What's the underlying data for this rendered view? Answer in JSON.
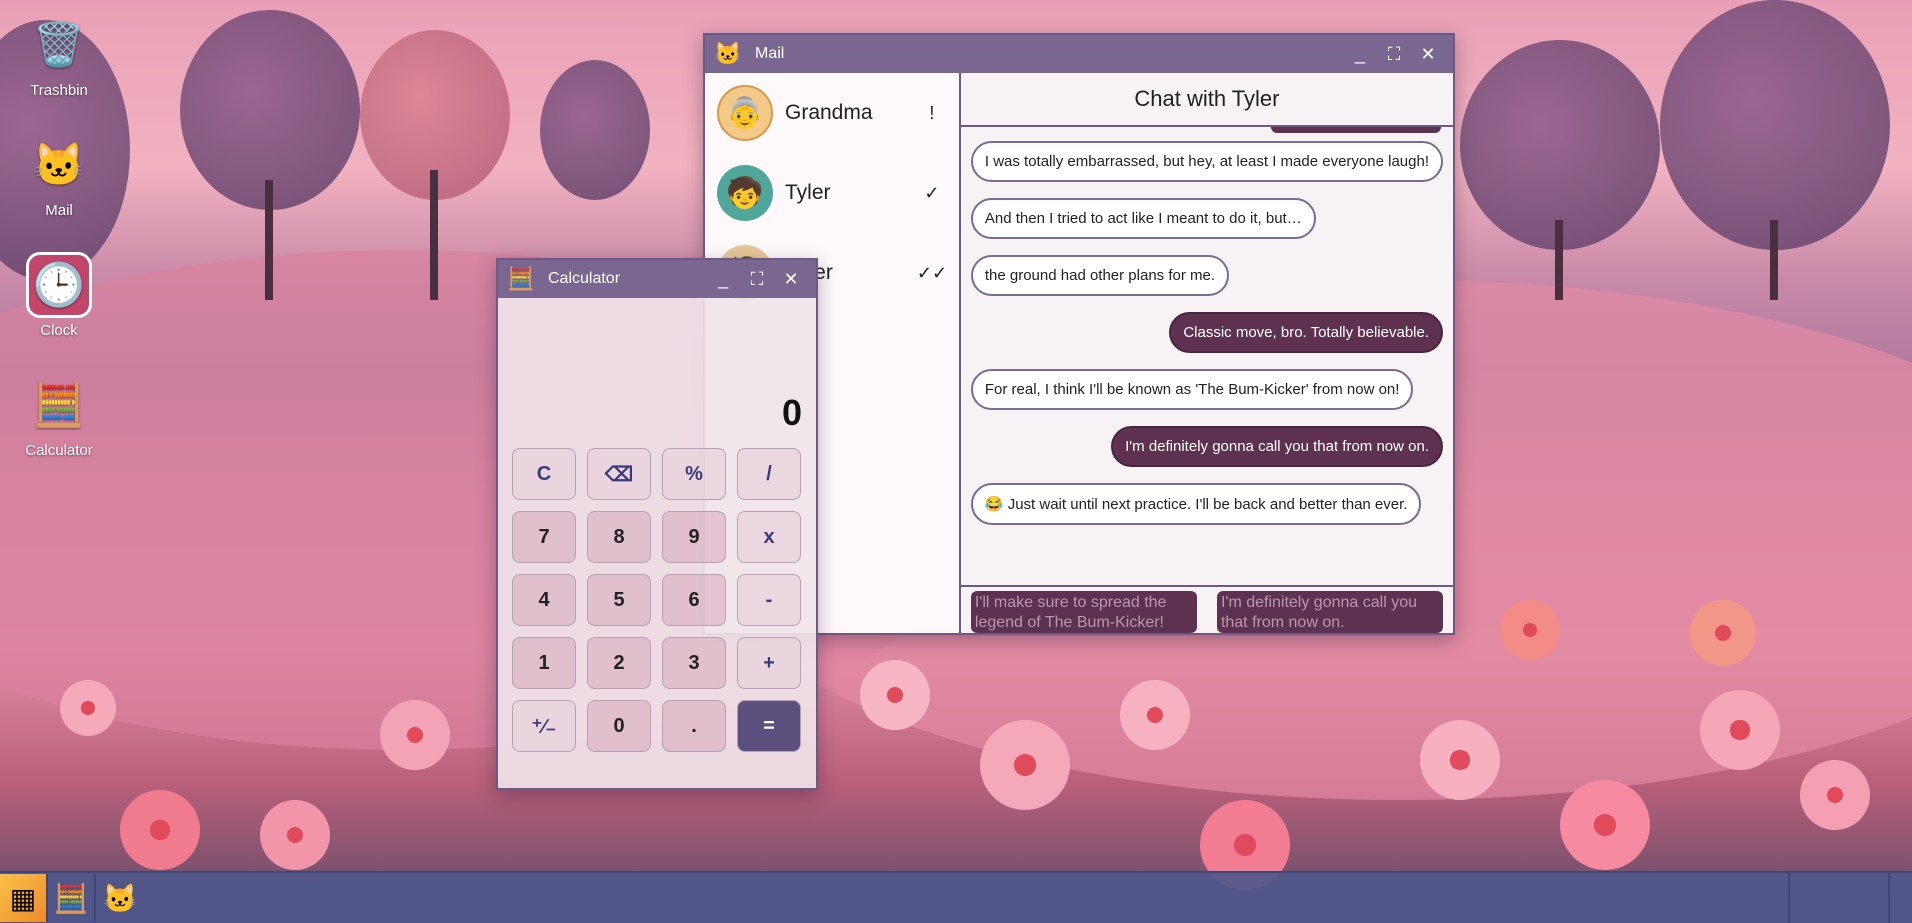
{
  "desktop": {
    "icons": [
      {
        "label": "Trashbin",
        "icon": "trash-bin-icon"
      },
      {
        "label": "Mail",
        "icon": "cat-mail-icon"
      },
      {
        "label": "Clock",
        "icon": "clock-icon"
      },
      {
        "label": "Calculator",
        "icon": "calculator-icon"
      }
    ]
  },
  "mail": {
    "title": "Mail",
    "contacts": [
      {
        "name": "Grandma",
        "status": "!"
      },
      {
        "name": "Tyler",
        "status": "✓"
      },
      {
        "name": "amer",
        "status": "✓✓"
      }
    ],
    "chat_title": "Chat with Tyler",
    "messages": [
      {
        "dir": "in",
        "text": "I was totally embarrassed, but hey, at least I made everyone laugh!"
      },
      {
        "dir": "in",
        "text": "And then I tried to act like I meant to do it, but…"
      },
      {
        "dir": "in",
        "text": "the ground had other plans for me."
      },
      {
        "dir": "out",
        "text": "Classic move, bro. Totally believable."
      },
      {
        "dir": "in",
        "text": "For real, I think I'll be known as 'The Bum-Kicker' from now on!"
      },
      {
        "dir": "out",
        "text": "I'm definitely gonna call you that from now on."
      },
      {
        "dir": "in",
        "text": "😂 Just wait until next practice. I'll be back and better than ever."
      }
    ],
    "replies": [
      "I'll make sure to spread the legend of The Bum-Kicker!",
      "I'm definitely gonna call you that from now on."
    ]
  },
  "calculator": {
    "title": "Calculator",
    "display": "0",
    "keys": [
      "C",
      "⌫",
      "%",
      "/",
      "7",
      "8",
      "9",
      "x",
      "4",
      "5",
      "6",
      "-",
      "1",
      "2",
      "3",
      "+",
      "⁺∕₋",
      "0",
      ".",
      "="
    ]
  },
  "colors": {
    "titlebar": "#7a6791",
    "outgoing_bubble": "#5e3150",
    "equals_key": "#5b4f7e",
    "taskbar": "#4e568c"
  }
}
